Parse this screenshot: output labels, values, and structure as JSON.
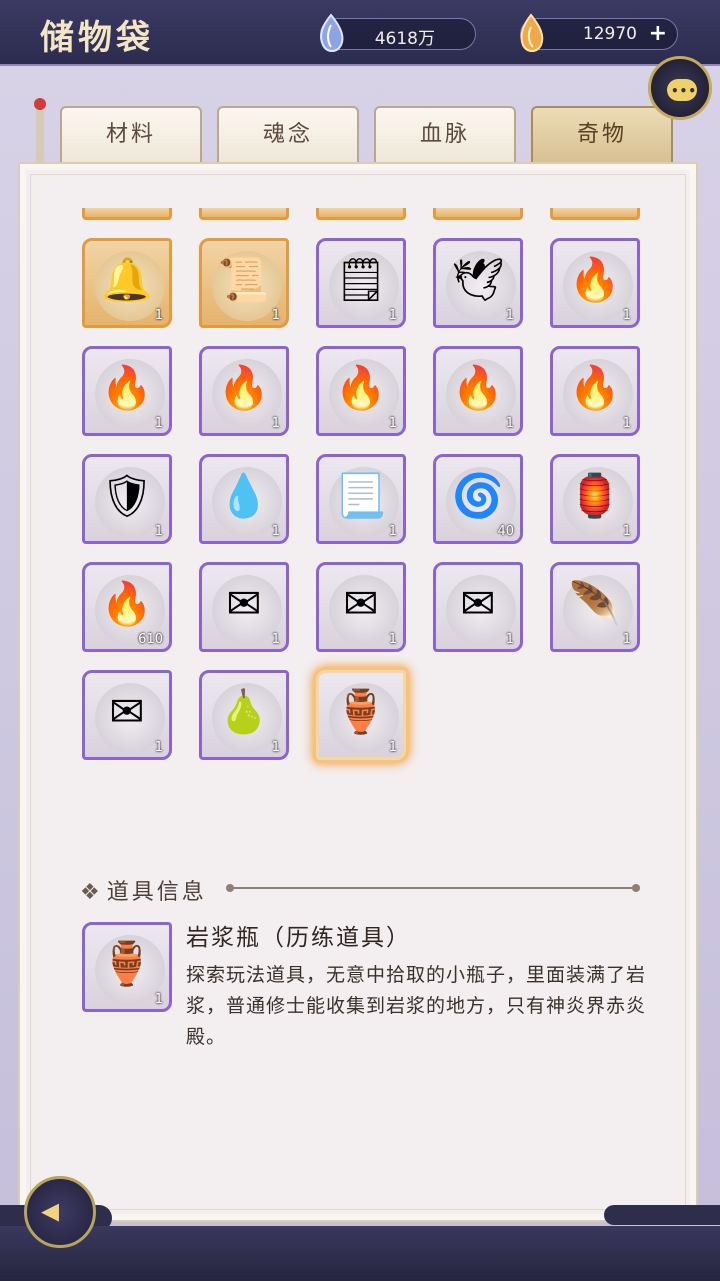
{
  "header": {
    "title": "储物袋",
    "currency_1": {
      "icon": "soul-gem-icon",
      "value": "4618万"
    },
    "currency_2": {
      "icon": "flame-coin-icon",
      "value": "12970",
      "add_label": "+"
    }
  },
  "tabs": [
    {
      "label": "材料",
      "active": false
    },
    {
      "label": "魂念",
      "active": false
    },
    {
      "label": "血脉",
      "active": false
    },
    {
      "label": "奇物",
      "active": true
    }
  ],
  "chat": {
    "icon": "chat-bubble-icon",
    "dots": "•••"
  },
  "items": [
    {
      "icon": "bell-ornament-icon",
      "glyph": "🔔",
      "count": "1",
      "rarity": "gold"
    },
    {
      "icon": "scroll-icon",
      "glyph": "📜",
      "count": "1",
      "rarity": "gold"
    },
    {
      "icon": "talisman-icon",
      "glyph": "🗒",
      "count": "1",
      "rarity": "purple"
    },
    {
      "icon": "wings-icon",
      "glyph": "🕊",
      "count": "1",
      "rarity": "purple"
    },
    {
      "icon": "fire-orb-icon",
      "glyph": "🔥",
      "count": "1",
      "rarity": "purple"
    },
    {
      "icon": "fire-orb-icon",
      "glyph": "🔥",
      "count": "1",
      "rarity": "purple"
    },
    {
      "icon": "fire-orb-icon",
      "glyph": "🔥",
      "count": "1",
      "rarity": "purple"
    },
    {
      "icon": "fire-orb-icon",
      "glyph": "🔥",
      "count": "1",
      "rarity": "purple"
    },
    {
      "icon": "fire-orb-icon",
      "glyph": "🔥",
      "count": "1",
      "rarity": "purple"
    },
    {
      "icon": "fire-orb-icon",
      "glyph": "🔥",
      "count": "1",
      "rarity": "purple"
    },
    {
      "icon": "amulet-icon",
      "glyph": "🛡",
      "count": "1",
      "rarity": "purple"
    },
    {
      "icon": "water-drop-icon",
      "glyph": "💧",
      "count": "1",
      "rarity": "purple"
    },
    {
      "icon": "paper-scroll-icon",
      "glyph": "📃",
      "count": "1",
      "rarity": "purple"
    },
    {
      "icon": "blue-flame-icon",
      "glyph": "🌀",
      "count": "40",
      "rarity": "purple"
    },
    {
      "icon": "divine-seal-icon",
      "glyph": "🏮",
      "count": "1",
      "rarity": "purple"
    },
    {
      "icon": "golden-flame-icon",
      "glyph": "🔥",
      "count": "610",
      "rarity": "purple"
    },
    {
      "icon": "letter-icon",
      "glyph": "✉",
      "count": "1",
      "rarity": "purple"
    },
    {
      "icon": "letter-icon",
      "glyph": "✉",
      "count": "1",
      "rarity": "purple"
    },
    {
      "icon": "letter-icon",
      "glyph": "✉",
      "count": "1",
      "rarity": "purple"
    },
    {
      "icon": "red-feather-icon",
      "glyph": "🪶",
      "count": "1",
      "rarity": "purple"
    },
    {
      "icon": "letter-icon",
      "glyph": "✉",
      "count": "1",
      "rarity": "purple"
    },
    {
      "icon": "gourd-icon",
      "glyph": "🍐",
      "count": "1",
      "rarity": "purple"
    },
    {
      "icon": "magma-bottle-icon",
      "glyph": "🏺",
      "count": "1",
      "rarity": "purple",
      "selected": true
    }
  ],
  "info": {
    "header": "道具信息",
    "diamond": "❖",
    "item_icon": "magma-bottle-icon",
    "item_glyph": "🏺",
    "item_count": "1",
    "name": "岩浆瓶（历练道具）",
    "description": "探索玩法道具，无意中拾取的小瓶子，里面装满了岩浆，普通修士能收集到岩浆的地方，只有神炎界赤炎殿。"
  },
  "back_button": {
    "icon": "back-arrow-icon",
    "glyph": "◂"
  }
}
